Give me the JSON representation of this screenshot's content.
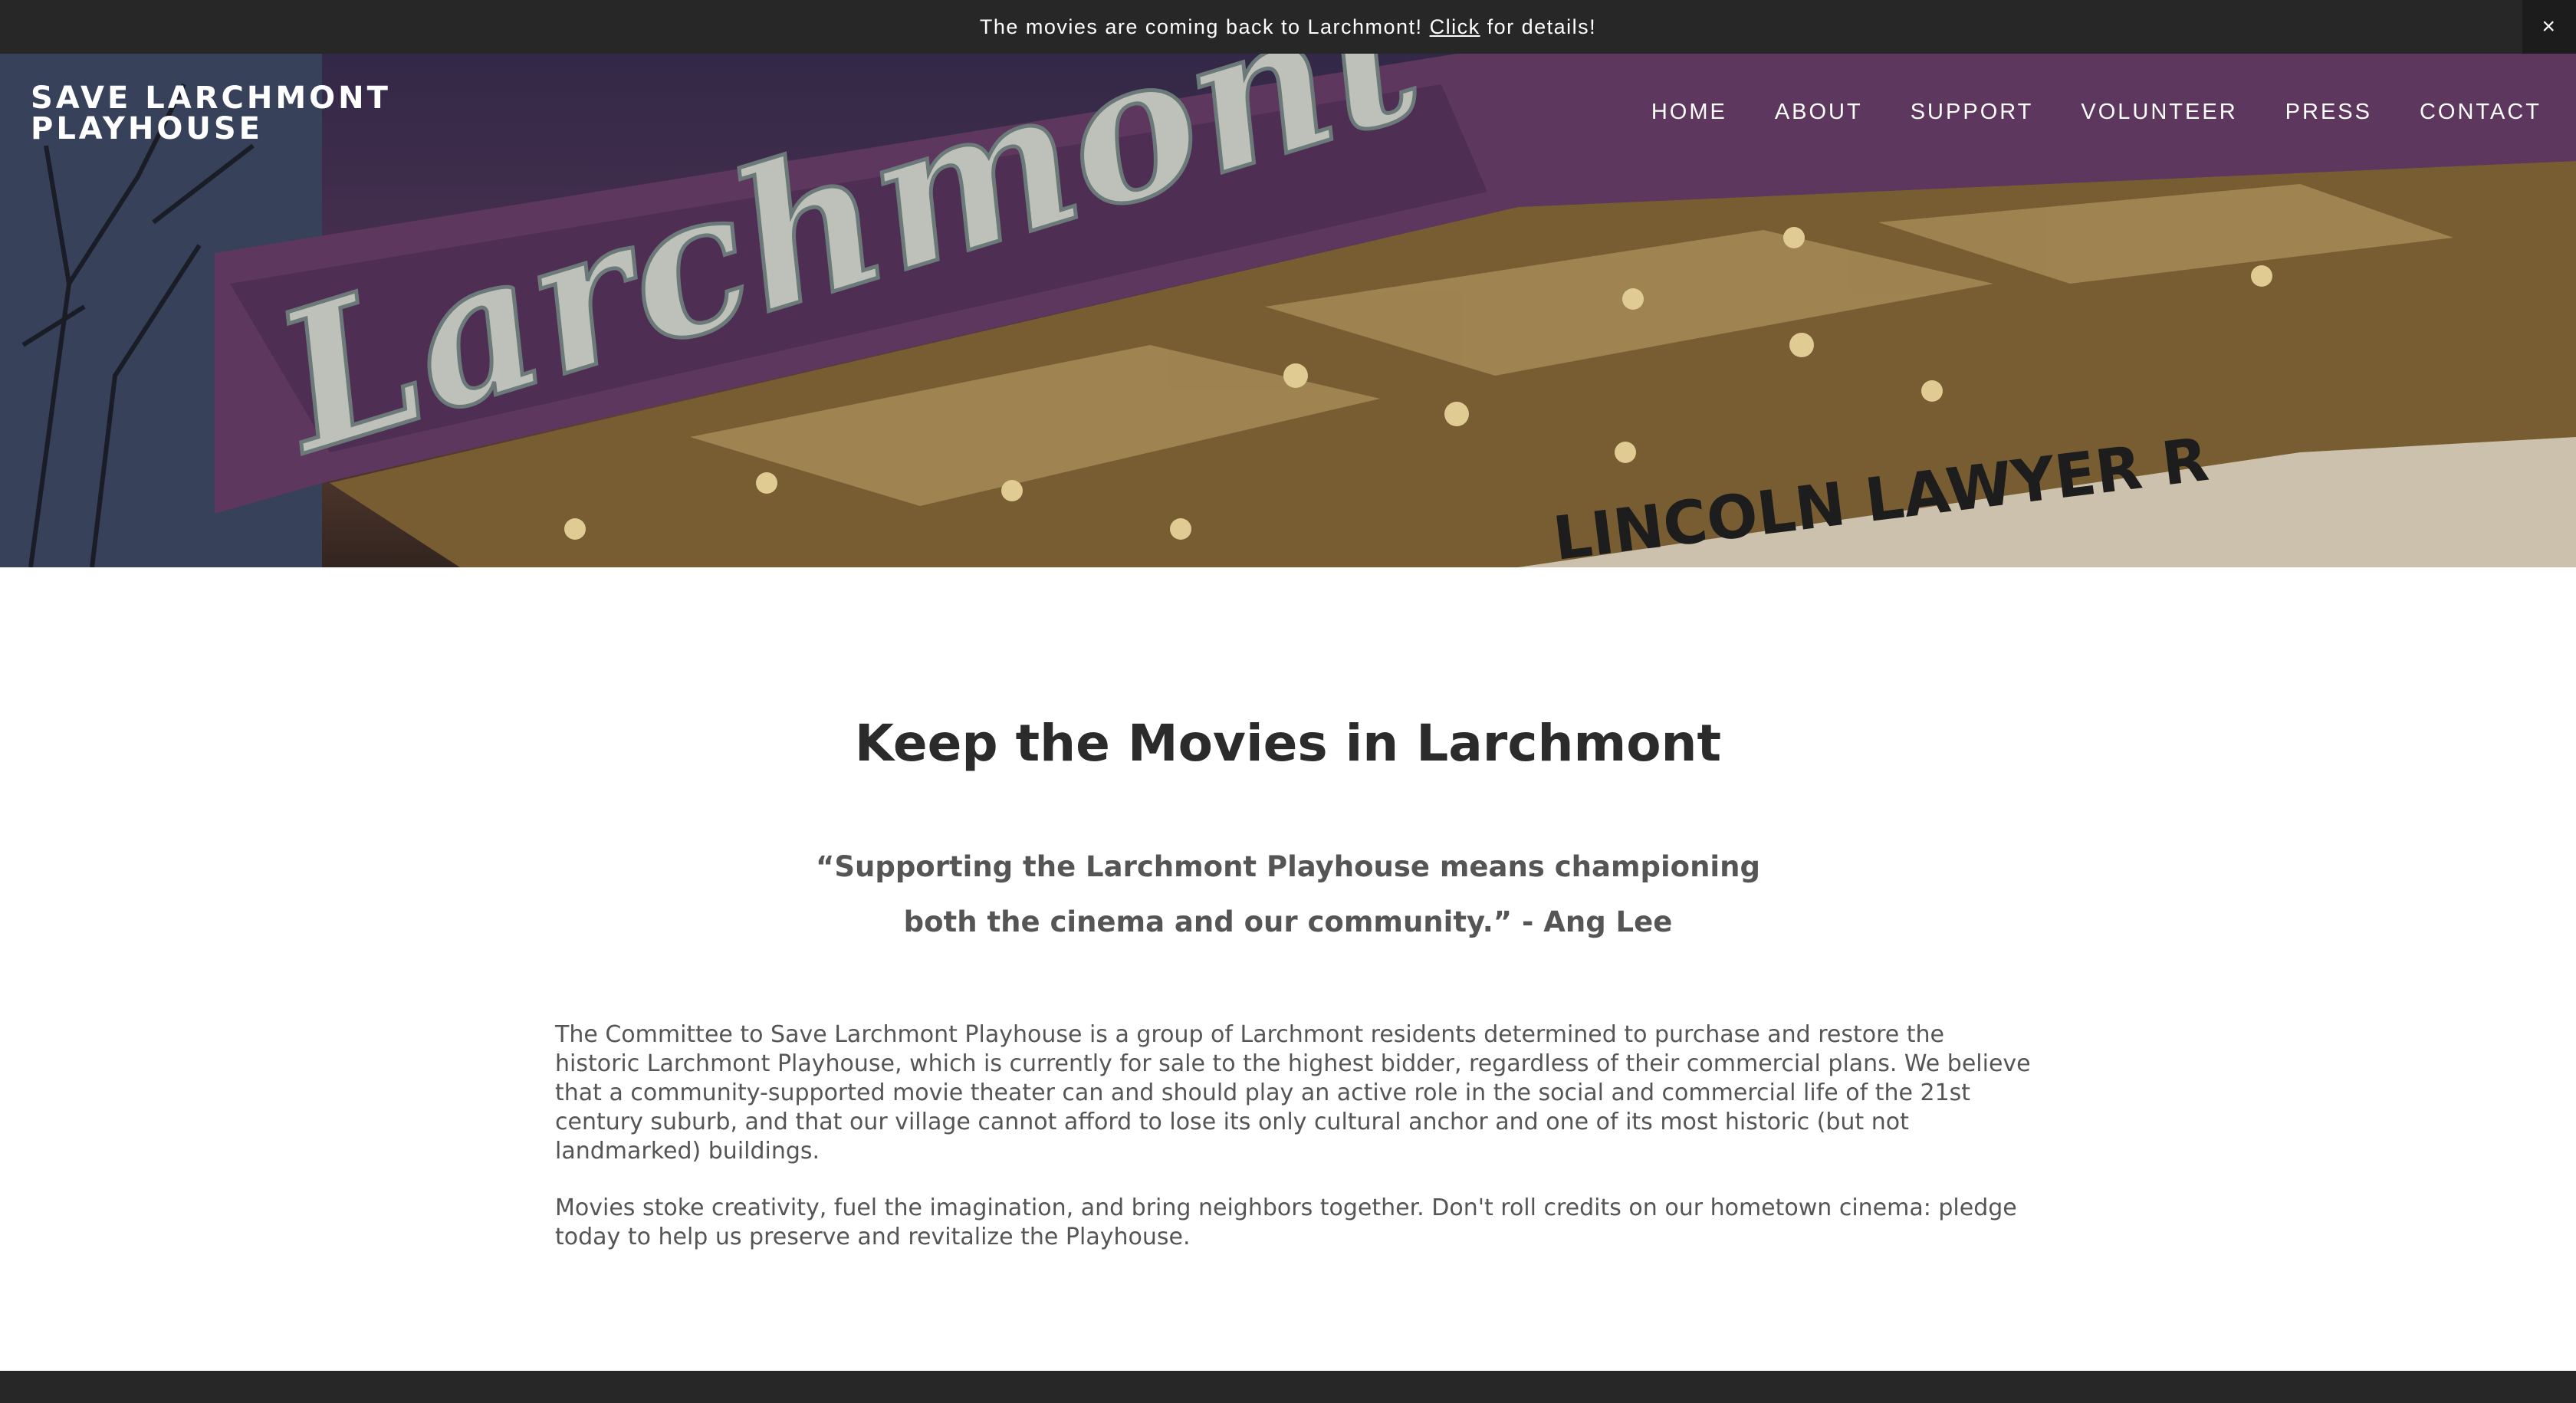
{
  "announcement": {
    "before": "The movies are coming back to Larchmont!",
    "link": "Click",
    "after": "for details!",
    "close": "×"
  },
  "brand": {
    "title": "SAVE LARCHMONT PLAYHOUSE"
  },
  "nav": [
    "HOME",
    "ABOUT",
    "SUPPORT",
    "VOLUNTEER",
    "PRESS",
    "CONTACT"
  ],
  "hero": {
    "sign_text": "Larchmont",
    "marquee_text": "LINCOLN LAWYER R"
  },
  "main": {
    "heading": "Keep the Movies in Larchmont",
    "quote": "“Supporting the Larchmont Playhouse means championing both the cinema and our community.” - Ang Lee",
    "paragraphs": [
      "The Committee to Save Larchmont Playhouse is a group of Larchmont residents determined to purchase and restore the historic Larchmont Playhouse, which is currently for sale to the highest bidder, regardless of their commercial plans.  We believe that a community-supported movie theater can and should play an active role in the social and commercial life of the 21st century suburb, and that our village cannot afford to lose its only cultural anchor and one of its most historic (but not landmarked) buildings.",
      "Movies stoke creativity, fuel the imagination, and bring neighbors together. Don't roll credits on our hometown cinema: pledge today to help us preserve and revitalize the Playhouse."
    ]
  },
  "colors": {
    "bar": "#272727",
    "heading": "#2b2b2b",
    "text": "#555555"
  }
}
